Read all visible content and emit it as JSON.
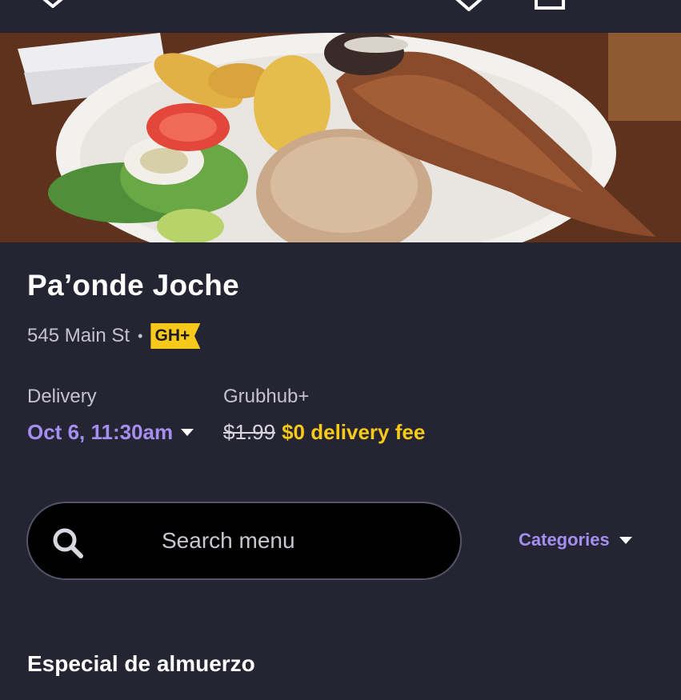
{
  "colors": {
    "background": "#252433",
    "accent_purple": "#a48ef0",
    "accent_yellow": "#f6c91b",
    "muted_text": "#c4c3cc",
    "search_bg": "#000000"
  },
  "topbar": {
    "icons": [
      "chevron-down-icon",
      "heart-icon",
      "share-icon"
    ]
  },
  "hero": {
    "image": "plate-of-fried-fish-rice-salad-photo"
  },
  "restaurant": {
    "name": "Pa’onde Joche",
    "address": "545 Main St",
    "separator": "•",
    "badge": "GH+"
  },
  "delivery": {
    "label": "Delivery",
    "time": "Oct 6, 11:30am"
  },
  "grubhub_plus": {
    "label": "Grubhub+",
    "old_fee": "$1.99",
    "new_fee": "$0 delivery fee"
  },
  "search": {
    "placeholder": "Search menu",
    "icon": "search-icon"
  },
  "categories": {
    "label": "Categories"
  },
  "menu": {
    "section_title": "Especial de almuerzo"
  }
}
